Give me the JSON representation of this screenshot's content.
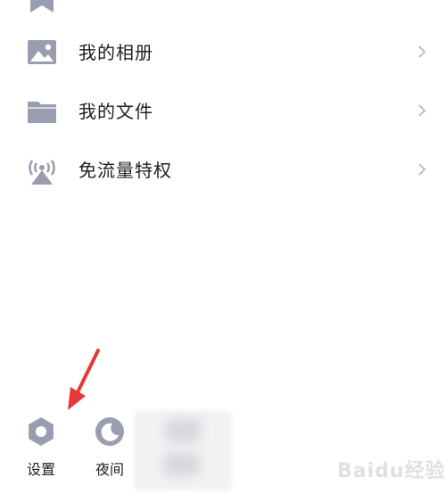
{
  "menu": {
    "items": [
      {
        "label": "我的相册",
        "icon": "photo-icon"
      },
      {
        "label": "我的文件",
        "icon": "folder-icon"
      },
      {
        "label": "免流量特权",
        "icon": "broadcast-tower-icon"
      }
    ]
  },
  "bottom_bar": {
    "settings_label": "设置",
    "night_label": "夜间"
  },
  "watermark": {
    "text": "Baidu经验"
  },
  "colors": {
    "icon": "#9a9db0",
    "text": "#1f1f1f",
    "chevron": "#b8b8bd",
    "arrow": "#e53935"
  }
}
